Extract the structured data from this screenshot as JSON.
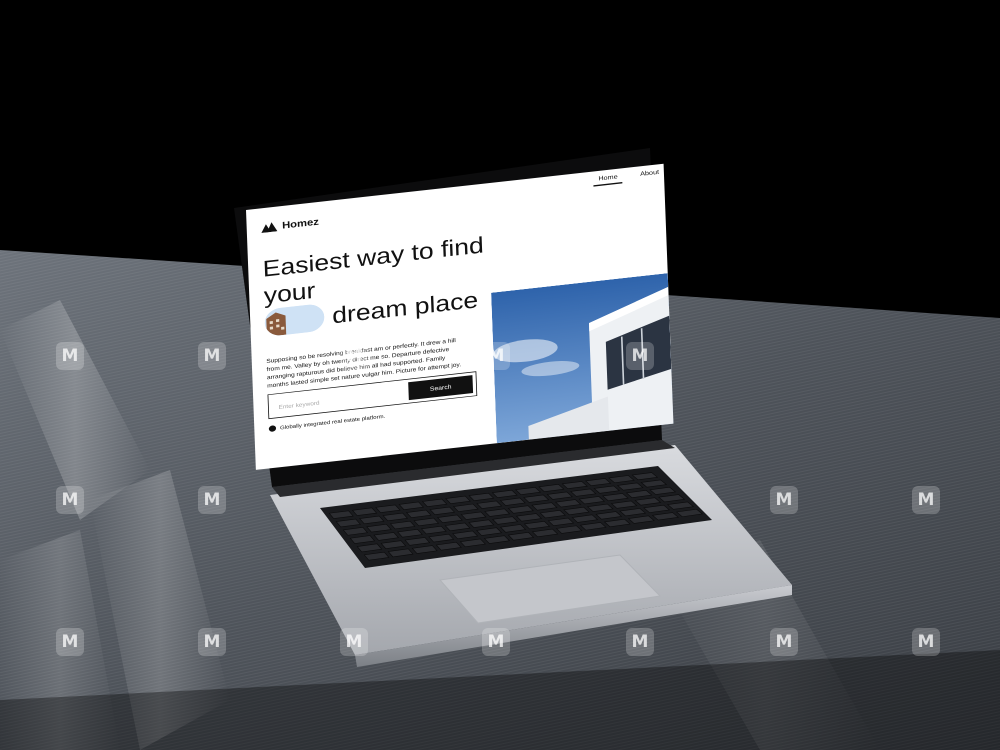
{
  "app": {
    "logo_text": "Homez"
  },
  "nav": {
    "items": [
      {
        "label": "Home",
        "active": true
      },
      {
        "label": "About",
        "active": false
      }
    ]
  },
  "hero": {
    "headline_line1": "Easiest way to find",
    "headline_line2": "your",
    "headline_line3": "dream place",
    "paragraph": "Supposing so be resolving breakfast am or perfectly. It drew a hill from me. Valley by oh twenty direct me so. Departure defective arranging rapturous did believe him all had supported. Family months lasted simple set nature vulgar him. Picture for attempt joy."
  },
  "search": {
    "placeholder": "Enter keyword",
    "button_label": "Search"
  },
  "tagline": "Globally integrated real estate platform.",
  "watermark": {
    "glyph": "M"
  },
  "colors": {
    "accent": "#111111",
    "sky": "#4f83c4",
    "desk": "#5b6068"
  }
}
